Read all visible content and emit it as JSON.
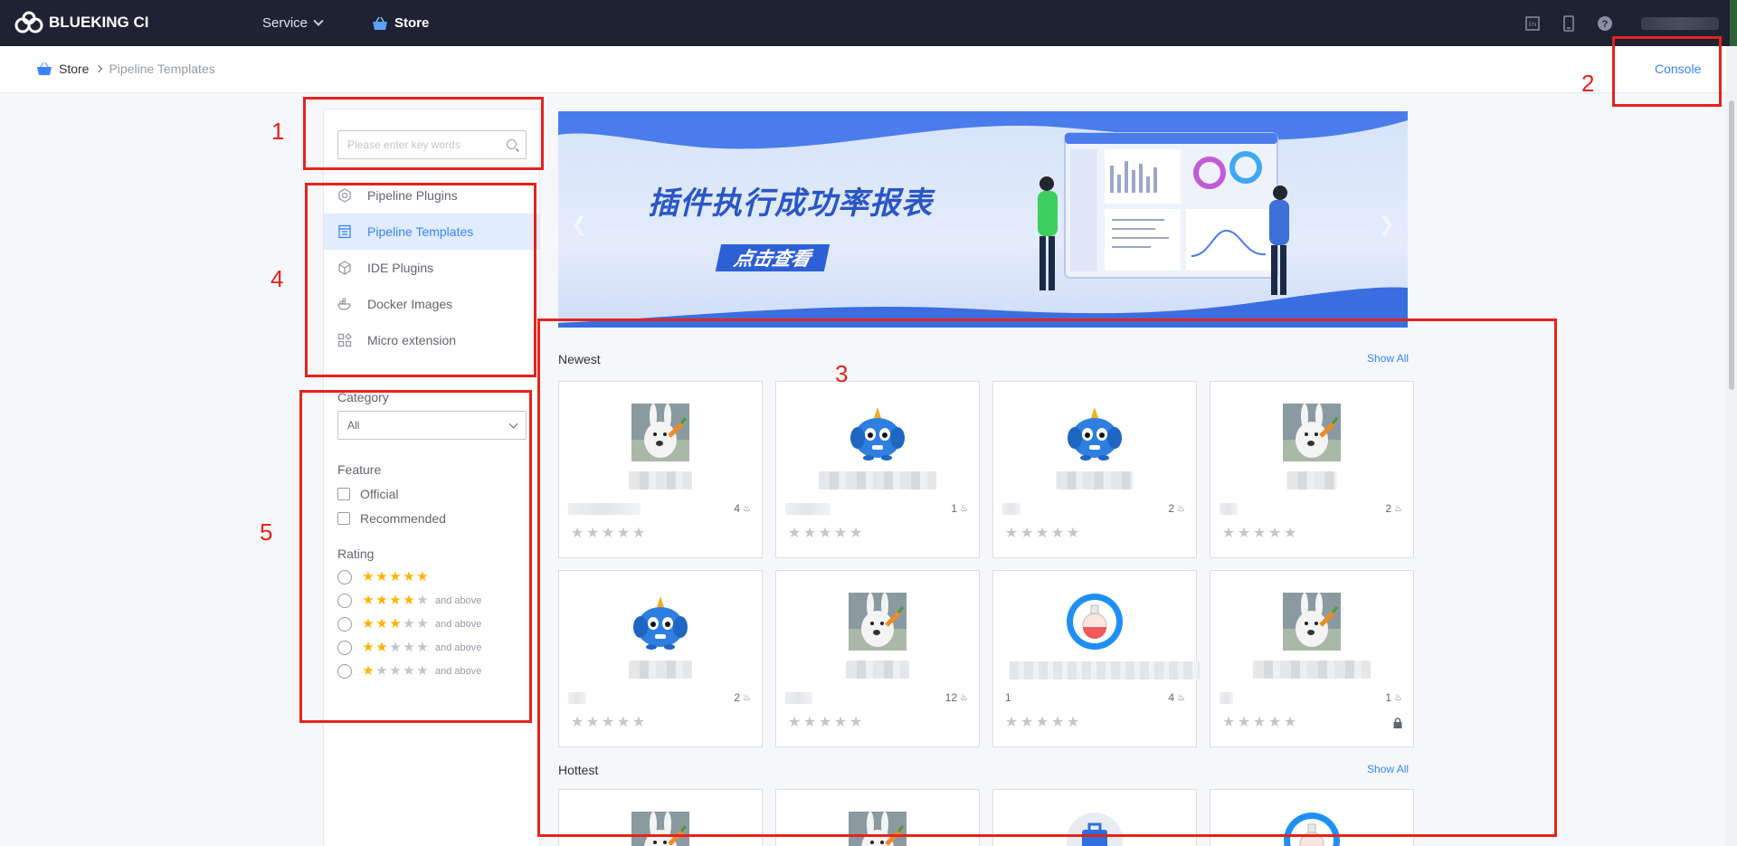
{
  "nav": {
    "brand": "BLUEKING CI",
    "service_label": "Service",
    "store_label": "Store"
  },
  "breadcrumb": {
    "root": "Store",
    "current": "Pipeline Templates"
  },
  "console_label": "Console",
  "search": {
    "placeholder": "Please enter key words"
  },
  "menu": [
    {
      "label": "Pipeline Plugins",
      "icon": "plugin-icon",
      "active": false
    },
    {
      "label": "Pipeline Templates",
      "icon": "template-icon",
      "active": true
    },
    {
      "label": "IDE Plugins",
      "icon": "cube-icon",
      "active": false
    },
    {
      "label": "Docker Images",
      "icon": "docker-icon",
      "active": false
    },
    {
      "label": "Micro extension",
      "icon": "grid-icon",
      "active": false
    }
  ],
  "filters": {
    "category_label": "Category",
    "category_value": "All",
    "feature_label": "Feature",
    "feature_options": [
      "Official",
      "Recommended"
    ],
    "rating_label": "Rating",
    "ratings": [
      {
        "stars": 5,
        "suffix": ""
      },
      {
        "stars": 4,
        "suffix": "and above"
      },
      {
        "stars": 3,
        "suffix": "and above"
      },
      {
        "stars": 2,
        "suffix": "and above"
      },
      {
        "stars": 1,
        "suffix": "and above"
      }
    ]
  },
  "banner": {
    "title": "插件执行成功率报表",
    "button": "点击查看"
  },
  "newest": {
    "title": "Newest",
    "show_all": "Show All",
    "cards": [
      {
        "avatar": "rabbit",
        "downloads": "4",
        "publisher": "",
        "locked": false
      },
      {
        "avatar": "monster",
        "downloads": "1",
        "publisher": "",
        "locked": false
      },
      {
        "avatar": "monster",
        "downloads": "2",
        "publisher": "",
        "locked": false
      },
      {
        "avatar": "rabbit",
        "downloads": "2",
        "publisher": "",
        "locked": false
      },
      {
        "avatar": "monster",
        "downloads": "2",
        "publisher": "",
        "locked": false
      },
      {
        "avatar": "rabbit",
        "downloads": "12",
        "publisher": "",
        "locked": false
      },
      {
        "avatar": "flask",
        "downloads": "4",
        "publisher": "1",
        "locked": false
      },
      {
        "avatar": "rabbit",
        "downloads": "1",
        "publisher": "",
        "locked": true
      }
    ]
  },
  "hottest": {
    "title": "Hottest",
    "show_all": "Show All",
    "cards": [
      {
        "avatar": "rabbit"
      },
      {
        "avatar": "rabbit"
      },
      {
        "avatar": "box"
      },
      {
        "avatar": "flask"
      }
    ]
  },
  "annotations": [
    "1",
    "2",
    "3",
    "4",
    "5"
  ],
  "colors": {
    "accent": "#3a84ff",
    "nav_bg": "#1f2233",
    "annotation": "#e3241d",
    "star_on": "#ffb400"
  }
}
